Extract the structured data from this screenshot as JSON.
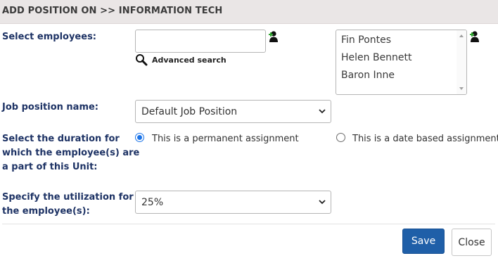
{
  "dialog": {
    "title": "ADD POSITION ON >> INFORMATION TECH"
  },
  "employees": {
    "label": "Select employees:",
    "search_value": "",
    "advanced_search_label": "Advanced search",
    "selected": [
      "Fin Pontes",
      "Helen Bennett",
      "Baron Inne"
    ]
  },
  "job_position": {
    "label": "Job position name:",
    "selected": "Default Job Position"
  },
  "duration": {
    "label_lines": [
      "Select the duration for",
      "which the employee(s) are",
      "a part of this Unit:"
    ],
    "options": [
      {
        "label": "This is a permanent assignment",
        "checked": true
      },
      {
        "label": "This is a date based assignment",
        "checked": false
      }
    ]
  },
  "utilization": {
    "label_lines": [
      "Specify the utilization for",
      "the employee(s):"
    ],
    "selected": "25%"
  },
  "actions": {
    "save_label": "Save",
    "close_label": "Close"
  },
  "icons": {
    "person_add": "add-person-icon",
    "search": "magnifier-icon",
    "chevron": "chevron-down-icon"
  },
  "colors": {
    "primary_button": "#1f5fa8",
    "label_text": "#1e3365",
    "header_bg": "#eae6e6",
    "radio_checked": "#1a73e8"
  }
}
